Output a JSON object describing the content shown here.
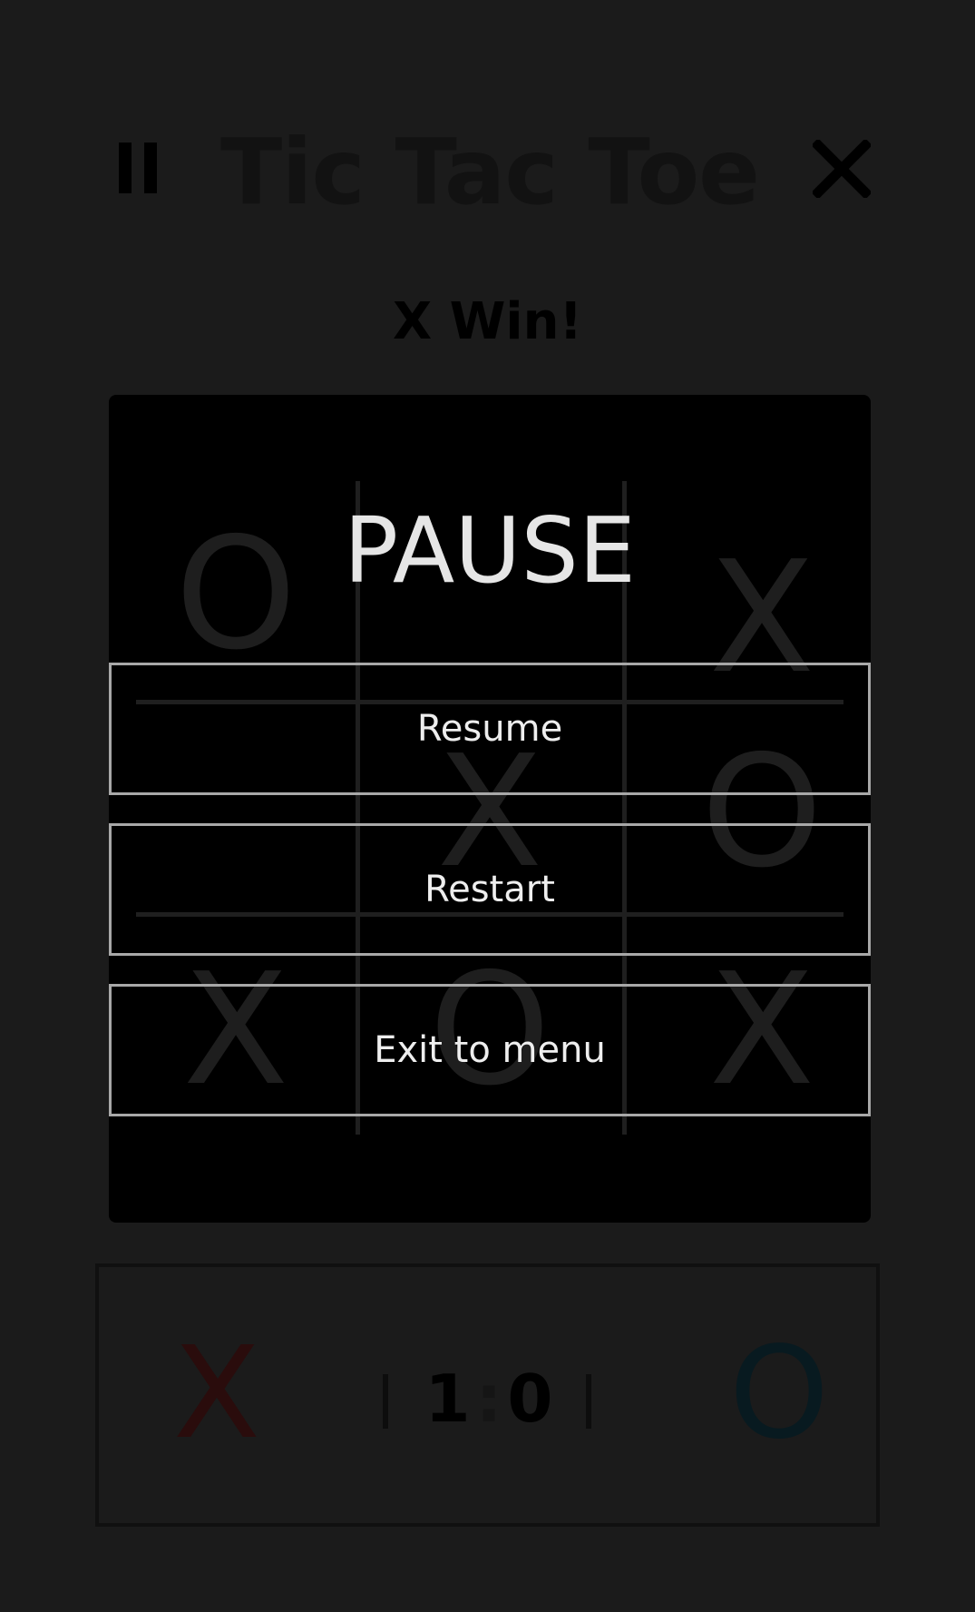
{
  "header": {
    "title": "Tic Tac Toe",
    "pause_icon": "pause-icon",
    "close_icon": "close-icon"
  },
  "status": "X Win!",
  "board": {
    "cells": [
      [
        "O",
        "",
        "X"
      ],
      [
        "",
        "X",
        "O"
      ],
      [
        "X",
        "O",
        "X"
      ]
    ]
  },
  "pause_menu": {
    "title": "PAUSE",
    "resume_label": "Resume",
    "restart_label": "Restart",
    "exit_label": "Exit to menu"
  },
  "score": {
    "player_x": "X",
    "player_o": "O",
    "x_score": "1",
    "separator": ":",
    "o_score": "0",
    "x_color": "#2a0c0c",
    "o_color": "#081a20"
  },
  "colors": {
    "background": "#1b1b1b",
    "panel": "#000000",
    "button_border": "#a8a8a8",
    "overlay_text": "#e6e6e6"
  }
}
